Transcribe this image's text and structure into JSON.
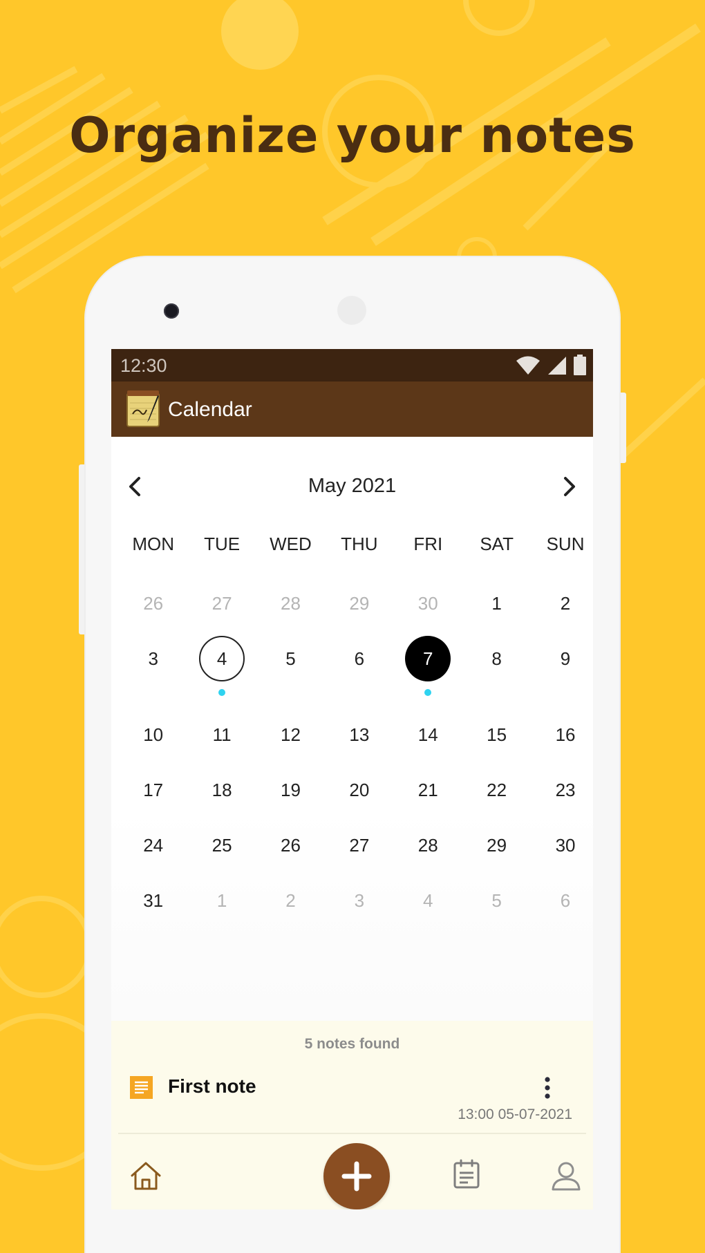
{
  "headline": "Organize your notes",
  "status_bar": {
    "time": "12:30",
    "icons": [
      "wifi-icon",
      "signal-icon",
      "battery-icon"
    ]
  },
  "app_bar": {
    "title": "Calendar",
    "logo_icon": "notepad-pen-icon"
  },
  "calendar": {
    "month_label": "May 2021",
    "prev_icon": "chevron-left-icon",
    "next_icon": "chevron-right-icon",
    "weekdays": [
      "MON",
      "TUE",
      "WED",
      "THU",
      "FRI",
      "SAT",
      "SUN"
    ],
    "weeks": [
      [
        {
          "d": "26",
          "muted": true
        },
        {
          "d": "27",
          "muted": true
        },
        {
          "d": "28",
          "muted": true
        },
        {
          "d": "29",
          "muted": true
        },
        {
          "d": "30",
          "muted": true
        },
        {
          "d": "1"
        },
        {
          "d": "2"
        }
      ],
      [
        {
          "d": "3"
        },
        {
          "d": "4",
          "today": true,
          "dot": true
        },
        {
          "d": "5"
        },
        {
          "d": "6"
        },
        {
          "d": "7",
          "selected": true,
          "dot": true
        },
        {
          "d": "8"
        },
        {
          "d": "9"
        }
      ],
      [
        {
          "d": "10"
        },
        {
          "d": "11"
        },
        {
          "d": "12"
        },
        {
          "d": "13"
        },
        {
          "d": "14"
        },
        {
          "d": "15"
        },
        {
          "d": "16"
        }
      ],
      [
        {
          "d": "17"
        },
        {
          "d": "18"
        },
        {
          "d": "19"
        },
        {
          "d": "20"
        },
        {
          "d": "21"
        },
        {
          "d": "22"
        },
        {
          "d": "23"
        }
      ],
      [
        {
          "d": "24"
        },
        {
          "d": "25"
        },
        {
          "d": "26"
        },
        {
          "d": "27"
        },
        {
          "d": "28"
        },
        {
          "d": "29"
        },
        {
          "d": "30"
        }
      ],
      [
        {
          "d": "31"
        },
        {
          "d": "1",
          "muted": true
        },
        {
          "d": "2",
          "muted": true
        },
        {
          "d": "3",
          "muted": true
        },
        {
          "d": "4",
          "muted": true
        },
        {
          "d": "5",
          "muted": true
        },
        {
          "d": "6",
          "muted": true
        }
      ]
    ],
    "collapse_icon": "chevron-up-icon"
  },
  "notes": {
    "count_label": "5 notes found",
    "items": [
      {
        "title": "First note",
        "date": "13:00 05-07-2021",
        "icon": "note-list-icon",
        "menu_icon": "more-vertical-icon"
      }
    ]
  },
  "bottom_nav": {
    "items": [
      "home-icon",
      "add-icon",
      "calendar-notes-icon",
      "profile-icon"
    ]
  },
  "colors": {
    "background": "#FFC72A",
    "headline": "#4A2D12",
    "status_bar": "#3D2411",
    "app_bar": "#5C3718",
    "fab": "#8A4E22",
    "event_dot": "#2FD3F0",
    "notes_panel": "#FDFBEB"
  }
}
